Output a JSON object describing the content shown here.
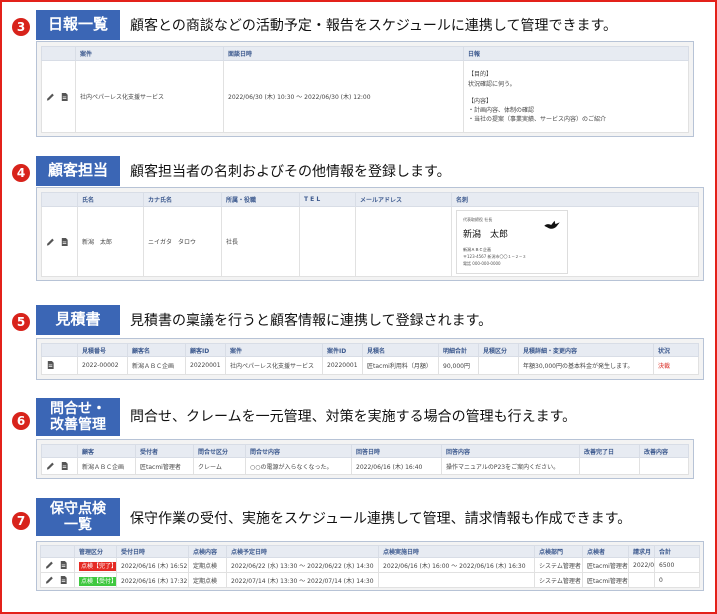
{
  "sections": [
    {
      "number": "3",
      "label": "日報一覧",
      "desc": "顧客との商談などの活動予定・報告をスケジュールに連携して管理できます。",
      "headers": [
        "案件",
        "面談日時",
        "日報"
      ],
      "row": {
        "case": "社内ペパーレス化支援サービス",
        "datetime": "2022/06/30 (木) 10:30 ～ 2022/06/30 (木) 12:00",
        "report": [
          "【目的】",
          "状況確認に伺う。",
          "",
          "【内容】",
          "・計画内容、体制の確認",
          "・当社の提案（事業実績、サービス内容）のご紹介"
        ]
      }
    },
    {
      "number": "4",
      "label": "顧客担当",
      "desc": "顧客担当者の名刺およびその他情報を登録します。",
      "headers": [
        "氏名",
        "カナ氏名",
        "所属・役職",
        "T E L",
        "メールアドレス",
        "名刺"
      ],
      "row": {
        "name": "新潟　太郎",
        "kana": "ニイガタ　タロウ",
        "title": "社長",
        "tel": "",
        "email": ""
      },
      "card": {
        "top": "代表取締役 社長",
        "name": "新潟　太郎",
        "company": "新潟ＡＢＣ企画",
        "address": "〒123-4567 新潟市〇〇１−２−３",
        "tel": "電話 000-000-0000"
      }
    },
    {
      "number": "5",
      "label": "見積書",
      "desc": "見積書の稟議を行うと顧客情報に連携して登録されます。",
      "headers": [
        "見積番号",
        "顧客名",
        "顧客ID",
        "案件",
        "案件ID",
        "見積名",
        "明細合計",
        "見積区分",
        "見積詳細・変更内容",
        "状況"
      ],
      "row": [
        "2022-00002",
        "新潟ＡＢＣ企画",
        "20220001",
        "社内ペパーレス化支援サービス",
        "20220001",
        "匠tacmi利用料（月額）",
        "90,000円",
        "",
        "年額30,000円の基本料金が発生します。",
        "決裁"
      ]
    },
    {
      "number": "6",
      "label": "問合せ・\n改善管理",
      "desc": "問合せ、クレームを一元管理、対策を実施する場合の管理も行えます。",
      "headers": [
        "顧客",
        "受付者",
        "問合せ区分",
        "問合せ内容",
        "回答日時",
        "回答内容",
        "改善完了日",
        "改善内容"
      ],
      "row": [
        "新潟ＡＢＣ企画",
        "匠tacmi管理者",
        "クレーム",
        "○○の電源が入らなくなった。",
        "2022/06/16 (木) 16:40",
        "操作マニュアルのP23をご案内ください。",
        "",
        ""
      ]
    },
    {
      "number": "7",
      "label": "保守点検\n一覧",
      "desc": "保守作業の受付、実施をスケジュール連携して管理、請求情報も作成できます。",
      "headers": [
        "管理区分",
        "受付日時",
        "点検内容",
        "点検予定日時",
        "点検実施日時",
        "点検部門",
        "点検者",
        "請求月",
        "合計"
      ],
      "rows": [
        [
          "点検【完了】",
          "2022/06/16 (木) 16:52",
          "定期点検",
          "2022/06/22 (水) 13:30 ～ 2022/06/22 (水) 14:30",
          "2022/06/16 (木) 16:00 ～ 2022/06/16 (木) 16:30",
          "システム管理者",
          "匠tacmi管理者",
          "2022/06",
          "6500"
        ],
        [
          "点検【受付】",
          "2022/06/16 (木) 17:32",
          "定期点検",
          "2022/07/14 (木) 13:30 ～ 2022/07/14 (木) 14:30",
          "",
          "システム管理者",
          "匠tacmi管理者",
          "",
          "0"
        ]
      ]
    }
  ],
  "icons": {
    "edit": "pencil-icon",
    "view": "document-icon",
    "logo": "bird-icon"
  },
  "colors": {
    "frame": "#e3211a",
    "label": "#3b66b5",
    "number": "#d8231b",
    "done": "#e52b24",
    "received": "#3fc83f"
  }
}
